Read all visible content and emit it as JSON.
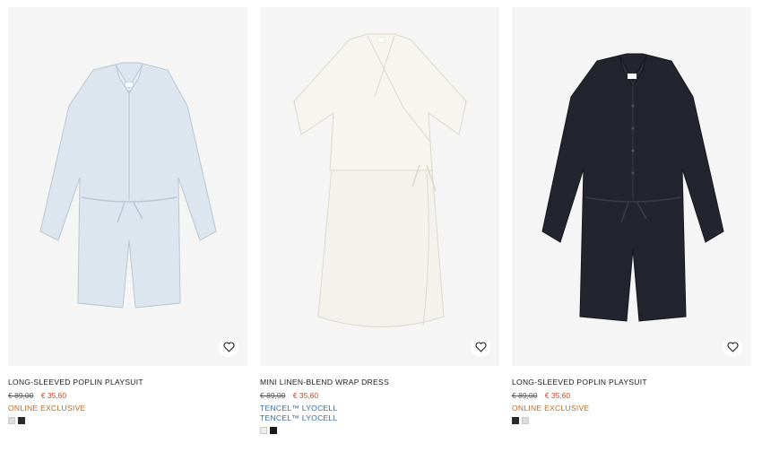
{
  "products": [
    {
      "name": "LONG-SLEEVED POPLIN PLAYSUIT",
      "price_old": "€ 89,00",
      "price_new": "€ 35,60",
      "tags": [
        "ONLINE EXCLUSIVE"
      ],
      "swatches": [
        "#d9dde2",
        "#2a2a2e"
      ],
      "icon": "heart-icon",
      "garment_color": "#dde6ef"
    },
    {
      "name": "MINI LINEN-BLEND WRAP DRESS",
      "price_old": "€ 89,00",
      "price_new": "€ 35,60",
      "tags": [
        "TENCEL™ LYOCELL",
        "TENCEL™ LYOCELL"
      ],
      "swatches": [
        "#eeeeee",
        "#1a1a1a"
      ],
      "icon": "heart-icon",
      "garment_color": "#f4f2ec"
    },
    {
      "name": "LONG-SLEEVED POPLIN PLAYSUIT",
      "price_old": "€ 89,00",
      "price_new": "€ 35,60",
      "tags": [
        "ONLINE EXCLUSIVE"
      ],
      "swatches": [
        "#2a2a2e",
        "#d9dde2"
      ],
      "icon": "heart-icon",
      "garment_color": "#23252e"
    }
  ],
  "colors": {
    "sale_price": "#c04a2e",
    "online_exclusive": "#b66a2a",
    "tencel": "#3a6a9a",
    "image_bg": "#f5f5f5"
  }
}
